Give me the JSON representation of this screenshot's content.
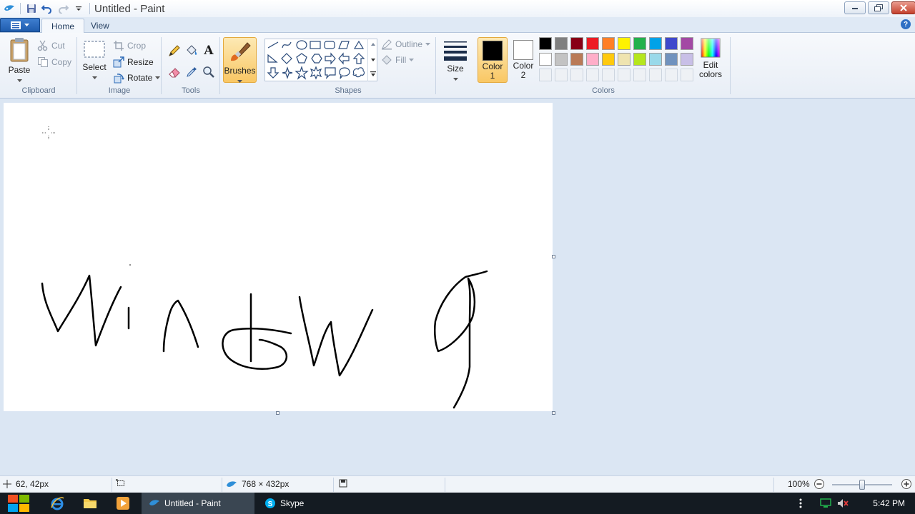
{
  "window": {
    "title": "Untitled - Paint"
  },
  "tabs": [
    {
      "label": "Home"
    },
    {
      "label": "View"
    }
  ],
  "clipboard": {
    "paste": "Paste",
    "cut": "Cut",
    "copy": "Copy",
    "label": "Clipboard"
  },
  "image": {
    "select": "Select",
    "crop": "Crop",
    "resize": "Resize",
    "rotate": "Rotate",
    "label": "Image"
  },
  "tools": {
    "label": "Tools"
  },
  "brushes": {
    "label": "Brushes"
  },
  "shapes": {
    "outline": "Outline",
    "fill": "Fill",
    "label": "Shapes"
  },
  "size": {
    "label": "Size"
  },
  "colors": {
    "color1_line1": "Color",
    "color1_line2": "1",
    "color2_line1": "Color",
    "color2_line2": "2",
    "edit_line1": "Edit",
    "edit_line2": "colors",
    "label": "Colors",
    "color1_value": "#000000",
    "color2_value": "#ffffff",
    "palette_row1": [
      "#000000",
      "#7f7f7f",
      "#880015",
      "#ed1c24",
      "#ff7f27",
      "#fff200",
      "#22b14c",
      "#00a2e8",
      "#3f48cc",
      "#a349a4"
    ],
    "palette_row2": [
      "#ffffff",
      "#c3c3c3",
      "#b97a57",
      "#ffaec9",
      "#ffc90e",
      "#efe4b0",
      "#b5e61d",
      "#99d9ea",
      "#7092be",
      "#c8bfe7"
    ]
  },
  "statusbar": {
    "cursor_pos": "62, 42px",
    "canvas_size": "768 × 432px",
    "zoom": "100%",
    "zoom_fraction": 0.5
  },
  "taskbar": {
    "tasks": [
      {
        "label": "Untitled - Paint"
      },
      {
        "label": "Skype"
      }
    ],
    "clock": "5:42 PM"
  }
}
